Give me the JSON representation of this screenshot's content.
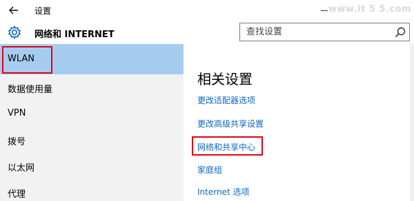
{
  "window": {
    "title": "设置",
    "watermark": "www.it 5 5.com"
  },
  "header": {
    "title": "网络和 INTERNET"
  },
  "search": {
    "placeholder": "查找设置"
  },
  "sidebar": {
    "items": [
      {
        "label": "WLAN",
        "selected": true
      },
      {
        "label": "数据使用量"
      },
      {
        "label": "VPN"
      },
      {
        "label": "拨号"
      },
      {
        "label": "以太网"
      },
      {
        "label": "代理"
      }
    ]
  },
  "content": {
    "section_title": "相关设置",
    "links": [
      {
        "label": "更改适配器选项"
      },
      {
        "label": "更改高级共享设置"
      },
      {
        "label": "网络和共享中心",
        "highlighted": true
      },
      {
        "label": "家庭组"
      },
      {
        "label": "Internet 选项"
      }
    ]
  },
  "colors": {
    "accent": "#0a68c0",
    "selected_bg": "#a6cdf0",
    "annotation_red": "#e0000f",
    "sidebar_bg": "#f2f2f2"
  },
  "icons": {
    "back": "arrow-left-icon",
    "header": "gear-icon",
    "search": "magnifier-icon",
    "window": "minimize-icon"
  }
}
